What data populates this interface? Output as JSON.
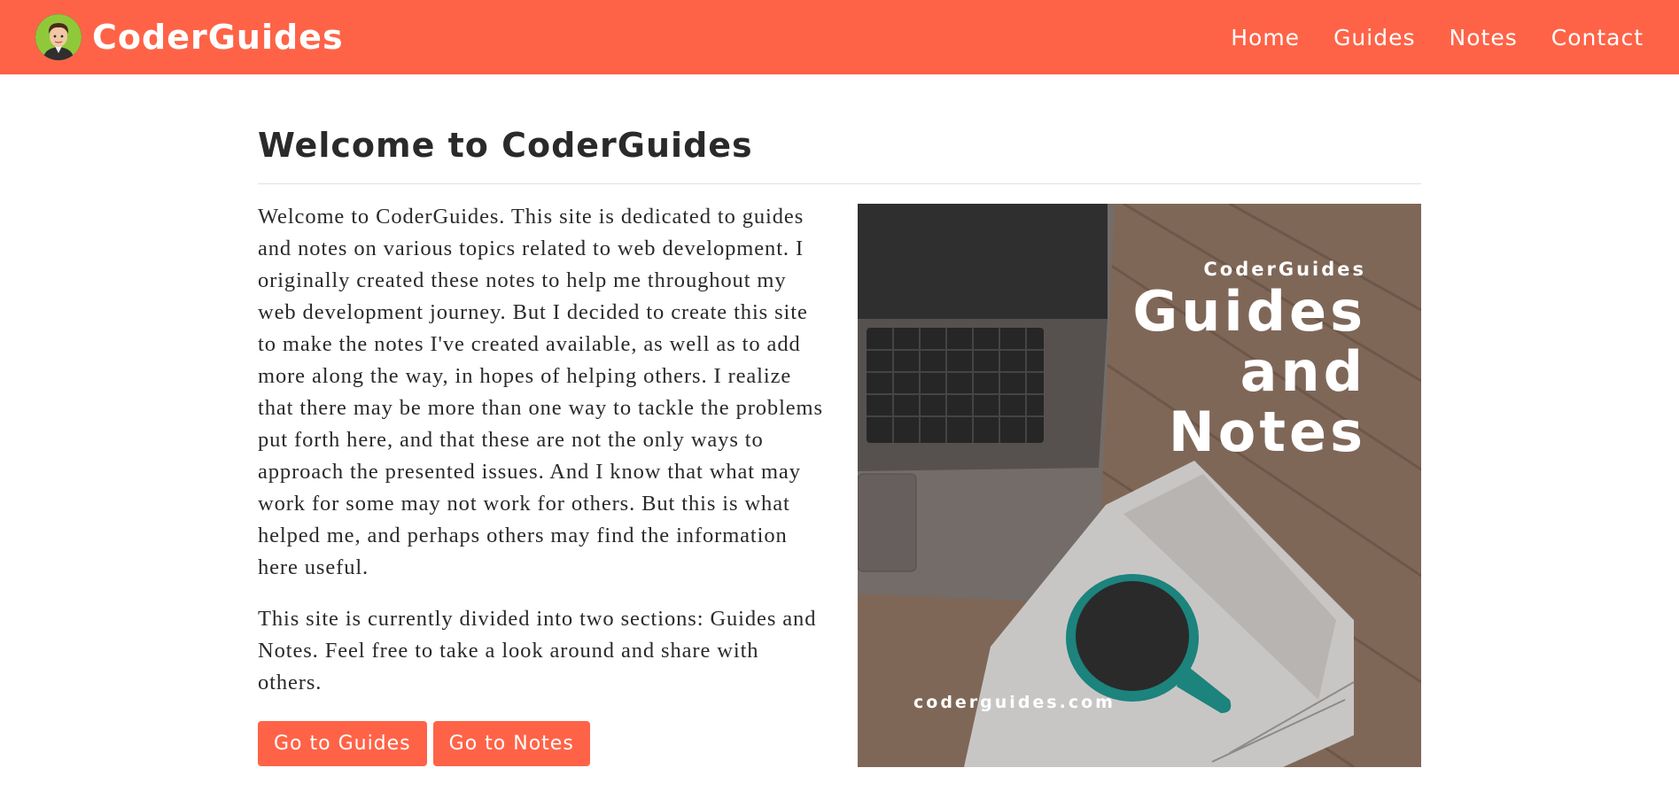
{
  "navbar": {
    "brand_name": "CoderGuides",
    "links": [
      {
        "label": "Home"
      },
      {
        "label": "Guides"
      },
      {
        "label": "Notes"
      },
      {
        "label": "Contact"
      }
    ],
    "color": "#ff6347"
  },
  "main": {
    "title": "Welcome to CoderGuides",
    "paragraphs": [
      "Welcome to CoderGuides. This site is dedicated to guides and notes on various topics related to web development. I originally created these notes to help me throughout my web development journey. But I decided to create this site to make the notes I've created available, as well as to add more along the way, in hopes of helping others. I realize that there may be more than one way to tackle the problems put forth here, and that these are not the only ways to approach the presented issues. And I know that what may work for some may not work for others. But this is what helped me, and perhaps others may find the information here useful.",
      "This site is currently divided into two sections: Guides and Notes. Feel free to take a look around and share with others."
    ],
    "buttons": {
      "guides": "Go to Guides",
      "notes": "Go to Notes"
    }
  },
  "hero_image": {
    "small_title": "CoderGuides",
    "line1": "Guides",
    "line2": "and",
    "line3": "Notes",
    "url": "coderguides.com"
  },
  "icons": [
    "avatar-logo-icon"
  ]
}
